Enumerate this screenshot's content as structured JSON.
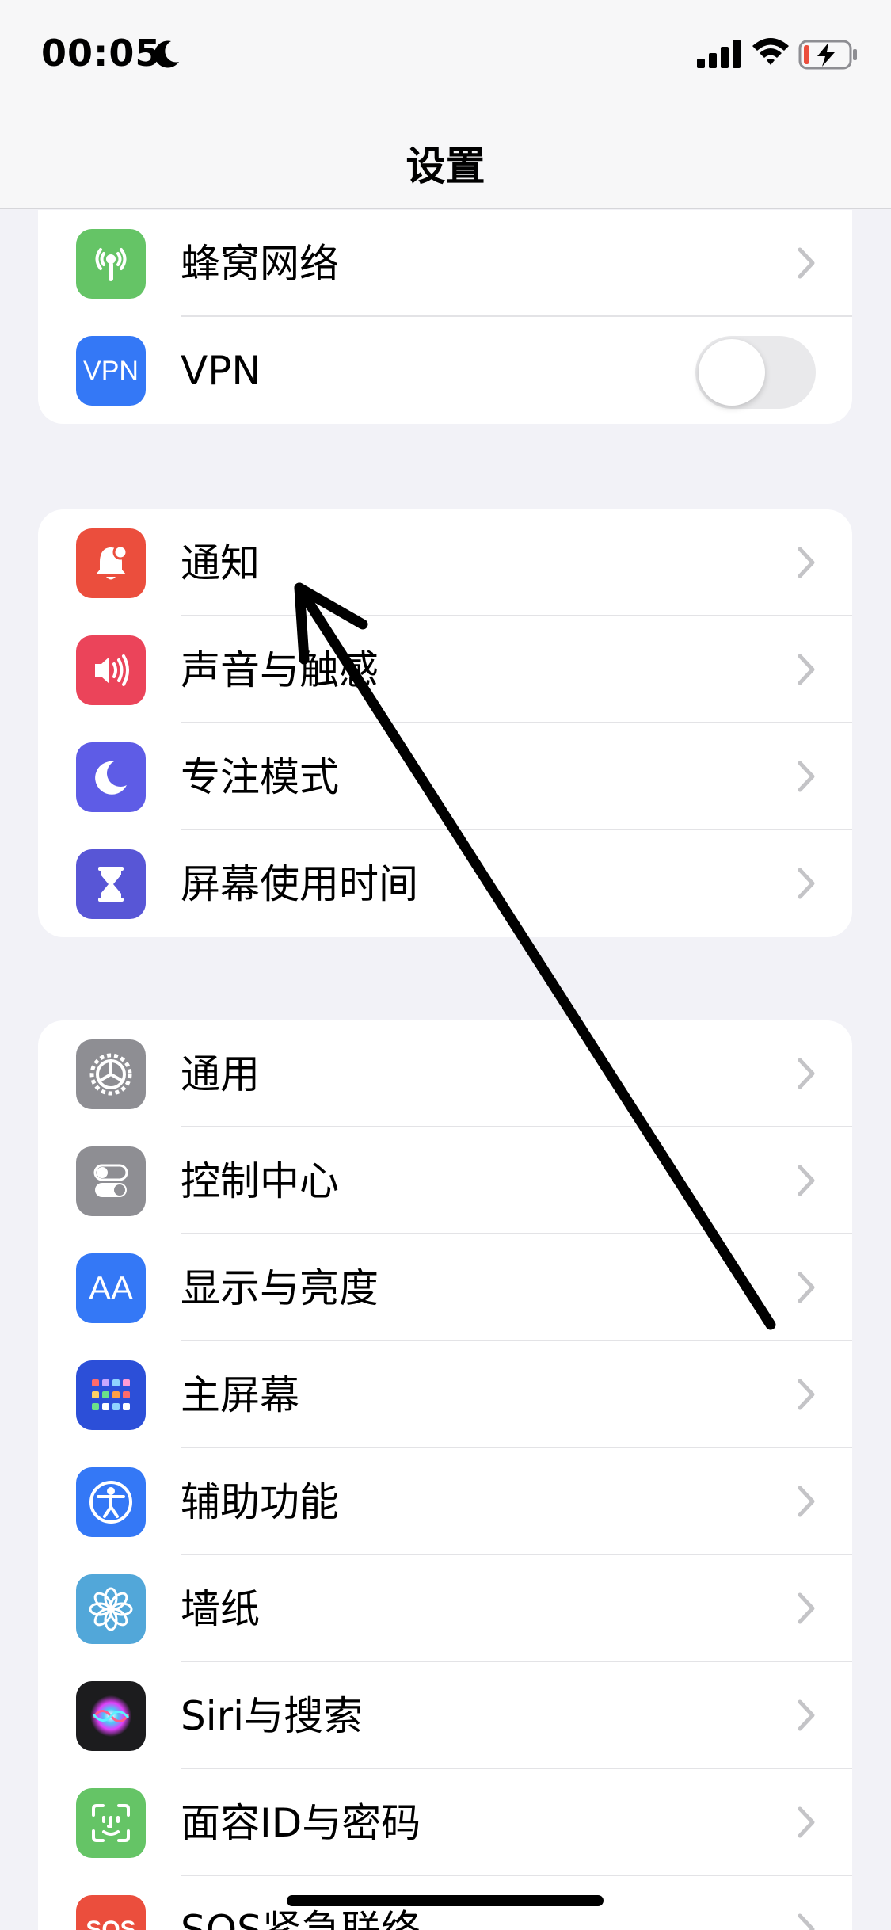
{
  "status_bar": {
    "time": "00:05",
    "icons": [
      "moon-icon",
      "signal-icon",
      "wifi-icon",
      "battery-charging-icon"
    ]
  },
  "nav": {
    "title": "设置"
  },
  "groups": [
    {
      "items": [
        {
          "label": "蜂窝网络",
          "icon": "antenna-icon",
          "color": "#65C466"
        },
        {
          "label": "VPN",
          "icon": "vpn-icon",
          "icon_text": "VPN",
          "color": "#3478F6",
          "toggle": false
        }
      ]
    },
    {
      "items": [
        {
          "label": "通知",
          "icon": "bell-icon",
          "color": "#EB4E3D"
        },
        {
          "label": "声音与触感",
          "icon": "speaker-icon",
          "color": "#EB445A"
        },
        {
          "label": "专注模式",
          "icon": "moon-icon",
          "color": "#5E5CE6"
        },
        {
          "label": "屏幕使用时间",
          "icon": "hourglass-icon",
          "color": "#5856D6"
        }
      ]
    },
    {
      "items": [
        {
          "label": "通用",
          "icon": "gear-icon",
          "color": "#8E8E93"
        },
        {
          "label": "控制中心",
          "icon": "switches-icon",
          "color": "#8E8E93"
        },
        {
          "label": "显示与亮度",
          "icon": "text-size-icon",
          "icon_text": "AA",
          "color": "#3478F6"
        },
        {
          "label": "主屏幕",
          "icon": "home-grid-icon",
          "color": "#2C4FD8"
        },
        {
          "label": "辅助功能",
          "icon": "accessibility-icon",
          "color": "#3478F6"
        },
        {
          "label": "墙纸",
          "icon": "flower-icon",
          "color": "#52A7D9"
        },
        {
          "label": "Siri与搜索",
          "icon": "siri-icon",
          "color": "#1C1C1E"
        },
        {
          "label": "面容ID与密码",
          "icon": "face-id-icon",
          "color": "#65C466"
        },
        {
          "label": "SOS紧急联络",
          "icon": "sos-icon",
          "icon_text": "SOS",
          "color": "#EB4E3D"
        }
      ]
    }
  ],
  "annotation": {
    "type": "arrow",
    "target": "通知",
    "color": "#000000"
  }
}
